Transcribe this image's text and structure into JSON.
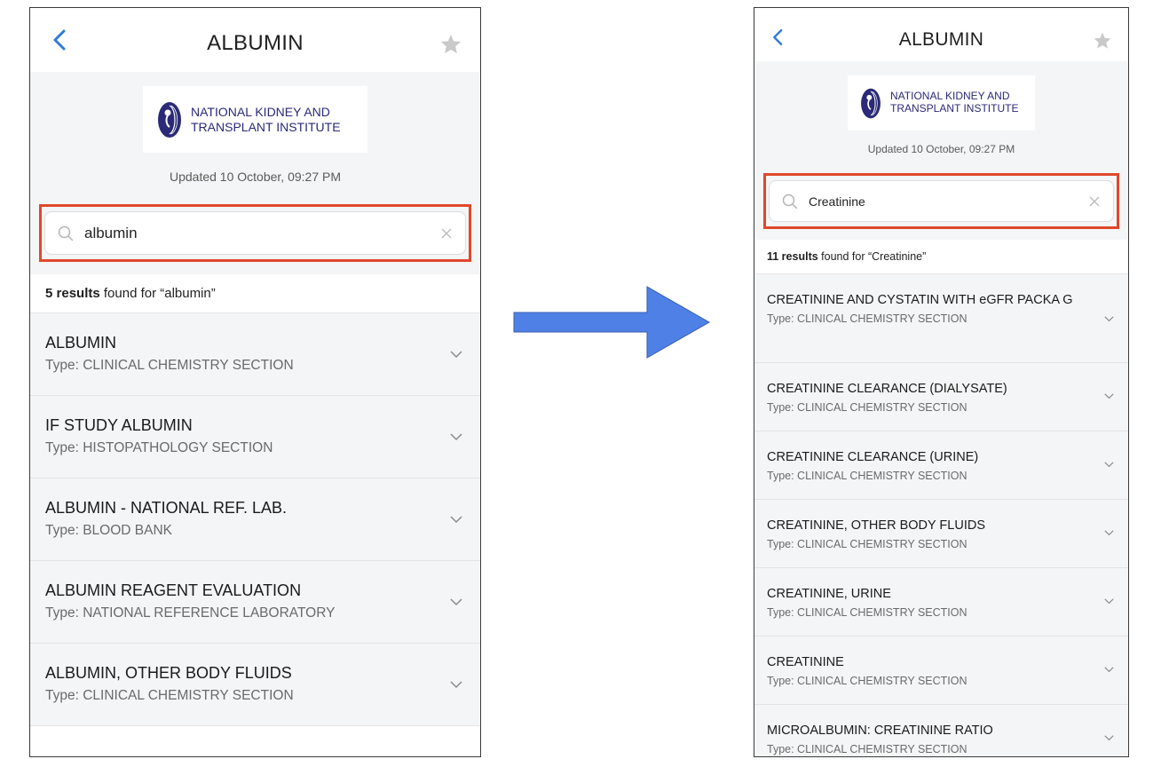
{
  "colors": {
    "accent": "#2f7bd9",
    "highlight": "#e0482b",
    "arrow": "#4f80e6",
    "logo": "#2a2a78"
  },
  "left_screen": {
    "header": {
      "title": "ALBUMIN",
      "back_icon": "chevron-left-icon",
      "favorite_icon": "star-icon"
    },
    "logo": {
      "line1": "NATIONAL KIDNEY AND",
      "line2": "TRANSPLANT INSTITUTE"
    },
    "updated": "Updated 10 October, 09:27 PM",
    "search": {
      "value": "albumin"
    },
    "results": {
      "count": "5 results",
      "suffix": " found for “albumin”"
    },
    "items": [
      {
        "name": "ALBUMIN",
        "type": "Type: CLINICAL CHEMISTRY SECTION"
      },
      {
        "name": "IF STUDY ALBUMIN",
        "type": "Type: HISTOPATHOLOGY SECTION"
      },
      {
        "name": "ALBUMIN - NATIONAL REF. LAB.",
        "type": "Type: BLOOD BANK"
      },
      {
        "name": "ALBUMIN REAGENT EVALUATION",
        "type": "Type: NATIONAL REFERENCE LABORATORY"
      },
      {
        "name": "ALBUMIN, OTHER BODY FLUIDS",
        "type": "Type: CLINICAL CHEMISTRY SECTION"
      }
    ]
  },
  "right_screen": {
    "header": {
      "title": "ALBUMIN",
      "back_icon": "chevron-left-icon",
      "favorite_icon": "star-icon"
    },
    "logo": {
      "line1": "NATIONAL KIDNEY AND",
      "line2": "TRANSPLANT INSTITUTE"
    },
    "updated": "Updated 10 October, 09:27 PM",
    "search": {
      "value": "Creatinine"
    },
    "results": {
      "count": "11 results",
      "suffix": " found for “Creatinine”"
    },
    "items": [
      {
        "name": "CREATININE AND CYSTATIN WITH eGFR PACKA G",
        "type": "Type: CLINICAL CHEMISTRY SECTION"
      },
      {
        "name": "CREATININE CLEARANCE (DIALYSATE)",
        "type": "Type: CLINICAL CHEMISTRY SECTION"
      },
      {
        "name": "CREATININE CLEARANCE (URINE)",
        "type": "Type: CLINICAL CHEMISTRY SECTION"
      },
      {
        "name": "CREATININE, OTHER BODY FLUIDS",
        "type": "Type: CLINICAL CHEMISTRY SECTION"
      },
      {
        "name": "CREATININE, URINE",
        "type": "Type: CLINICAL CHEMISTRY SECTION"
      },
      {
        "name": "CREATININE",
        "type": "Type: CLINICAL CHEMISTRY SECTION"
      },
      {
        "name": "MICROALBUMIN: CREATININE RATIO",
        "type": "Type: CLINICAL CHEMISTRY SECTION"
      }
    ]
  }
}
